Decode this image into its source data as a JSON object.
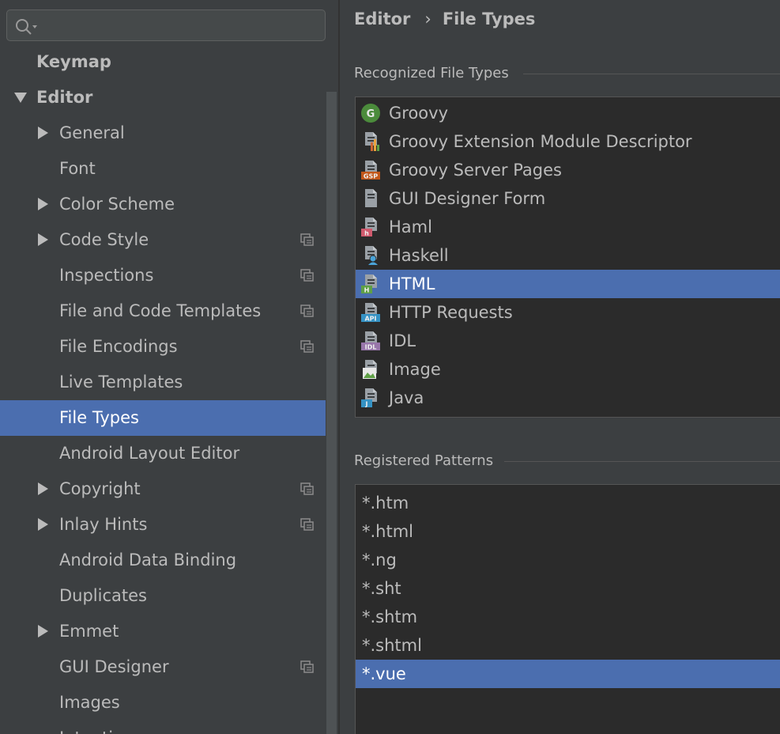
{
  "search": {
    "placeholder": "",
    "value": ""
  },
  "sidebar": {
    "items": [
      {
        "label": "Keymap",
        "level": 0,
        "arrow": "none",
        "project": false,
        "selected": false
      },
      {
        "label": "Editor",
        "level": 0,
        "arrow": "down",
        "project": false,
        "selected": false
      },
      {
        "label": "General",
        "level": 1,
        "arrow": "right",
        "project": false,
        "selected": false
      },
      {
        "label": "Font",
        "level": 1,
        "arrow": "none",
        "project": false,
        "selected": false
      },
      {
        "label": "Color Scheme",
        "level": 1,
        "arrow": "right",
        "project": false,
        "selected": false
      },
      {
        "label": "Code Style",
        "level": 1,
        "arrow": "right",
        "project": true,
        "selected": false
      },
      {
        "label": "Inspections",
        "level": 1,
        "arrow": "none",
        "project": true,
        "selected": false
      },
      {
        "label": "File and Code Templates",
        "level": 1,
        "arrow": "none",
        "project": true,
        "selected": false
      },
      {
        "label": "File Encodings",
        "level": 1,
        "arrow": "none",
        "project": true,
        "selected": false
      },
      {
        "label": "Live Templates",
        "level": 1,
        "arrow": "none",
        "project": false,
        "selected": false
      },
      {
        "label": "File Types",
        "level": 1,
        "arrow": "none",
        "project": false,
        "selected": true
      },
      {
        "label": "Android Layout Editor",
        "level": 1,
        "arrow": "none",
        "project": false,
        "selected": false
      },
      {
        "label": "Copyright",
        "level": 1,
        "arrow": "right",
        "project": true,
        "selected": false
      },
      {
        "label": "Inlay Hints",
        "level": 1,
        "arrow": "right",
        "project": true,
        "selected": false
      },
      {
        "label": "Android Data Binding",
        "level": 1,
        "arrow": "none",
        "project": false,
        "selected": false
      },
      {
        "label": "Duplicates",
        "level": 1,
        "arrow": "none",
        "project": false,
        "selected": false
      },
      {
        "label": "Emmet",
        "level": 1,
        "arrow": "right",
        "project": false,
        "selected": false
      },
      {
        "label": "GUI Designer",
        "level": 1,
        "arrow": "none",
        "project": true,
        "selected": false
      },
      {
        "label": "Images",
        "level": 1,
        "arrow": "none",
        "project": false,
        "selected": false
      },
      {
        "label": "Intentions",
        "level": 1,
        "arrow": "none",
        "project": false,
        "selected": false
      }
    ]
  },
  "breadcrumb": {
    "parent": "Editor",
    "separator": "›",
    "current": "File Types"
  },
  "recognized": {
    "title": "Recognized File Types",
    "items": [
      {
        "label": "Groovy",
        "icon": "groovy-icon",
        "badge": "G",
        "color": "#4b8b3b",
        "selected": false
      },
      {
        "label": "Groovy Extension Module Descriptor",
        "icon": "chart-file-icon",
        "badge": "",
        "color": "#e8a33d",
        "selected": false
      },
      {
        "label": "Groovy Server Pages",
        "icon": "gsp-file-icon",
        "badge": "GSP",
        "color": "#c2571a",
        "selected": false
      },
      {
        "label": "GUI Designer Form",
        "icon": "form-file-icon",
        "badge": "",
        "color": "#9aa0a6",
        "selected": false
      },
      {
        "label": "Haml",
        "icon": "haml-file-icon",
        "badge": "h",
        "color": "#d05a6e",
        "selected": false
      },
      {
        "label": "Haskell",
        "icon": "haskell-file-icon",
        "badge": "",
        "color": "#4aa3d8",
        "selected": false
      },
      {
        "label": "HTML",
        "icon": "html-file-icon",
        "badge": "H",
        "color": "#5fa046",
        "selected": true
      },
      {
        "label": "HTTP Requests",
        "icon": "api-file-icon",
        "badge": "API",
        "color": "#3592c4",
        "selected": false
      },
      {
        "label": "IDL",
        "icon": "idl-file-icon",
        "badge": "IDL",
        "color": "#9876aa",
        "selected": false
      },
      {
        "label": "Image",
        "icon": "image-file-icon",
        "badge": "",
        "color": "#5fa046",
        "selected": false
      },
      {
        "label": "Java",
        "icon": "java-file-icon",
        "badge": "J",
        "color": "#3592c4",
        "selected": false
      }
    ]
  },
  "patterns": {
    "title": "Registered Patterns",
    "items": [
      {
        "label": "*.htm",
        "selected": false
      },
      {
        "label": "*.html",
        "selected": false
      },
      {
        "label": "*.ng",
        "selected": false
      },
      {
        "label": "*.sht",
        "selected": false
      },
      {
        "label": "*.shtm",
        "selected": false
      },
      {
        "label": "*.shtml",
        "selected": false
      },
      {
        "label": "*.vue",
        "selected": true
      }
    ]
  },
  "colors": {
    "background": "#3c3f41",
    "list_background": "#2b2b2b",
    "selection": "#4b6eaf",
    "text": "#bbbbbb"
  }
}
